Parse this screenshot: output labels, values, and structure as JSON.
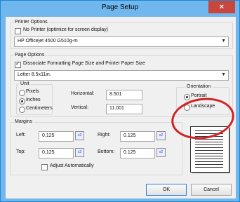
{
  "window": {
    "title": "Page Setup",
    "close_glyph": "×"
  },
  "printer_options": {
    "legend": "Printer Options",
    "no_printer_label": "No Printer (optimize for screen display)",
    "no_printer_checked": false,
    "printer_selected": "HP Officejet 4500 G510g-m"
  },
  "page_options": {
    "legend": "Page Options",
    "dissociate_label": "Dissociate Formatting Page Size and Printer Paper Size",
    "dissociate_checked": true,
    "paper_selected": "Letter 8.5x11in.",
    "unit": {
      "legend": "Unit",
      "options": [
        "Pixels",
        "Inches",
        "Centimeters"
      ],
      "selected": "Inches"
    },
    "horizontal_label": "Horizontal:",
    "horizontal_value": "8.501",
    "vertical_label": "Vertical:",
    "vertical_value": "11.001",
    "orientation": {
      "legend": "Orientation",
      "portrait": "Portrait",
      "landscape": "Landscape",
      "selected": "Portrait"
    }
  },
  "margins": {
    "legend": "Margins",
    "left_label": "Left:",
    "left_value": "0.125",
    "right_label": "Right:",
    "right_value": "0.125",
    "top_label": "Top:",
    "top_value": "0.125",
    "bottom_label": "Bottom:",
    "bottom_value": "0.125",
    "spin_glyph": "x2",
    "adjust_label": "Adjust Automatically",
    "adjust_checked": false
  },
  "buttons": {
    "ok": "OK",
    "cancel": "Cancel"
  },
  "annotation": {
    "ring_color": "#d42223"
  }
}
